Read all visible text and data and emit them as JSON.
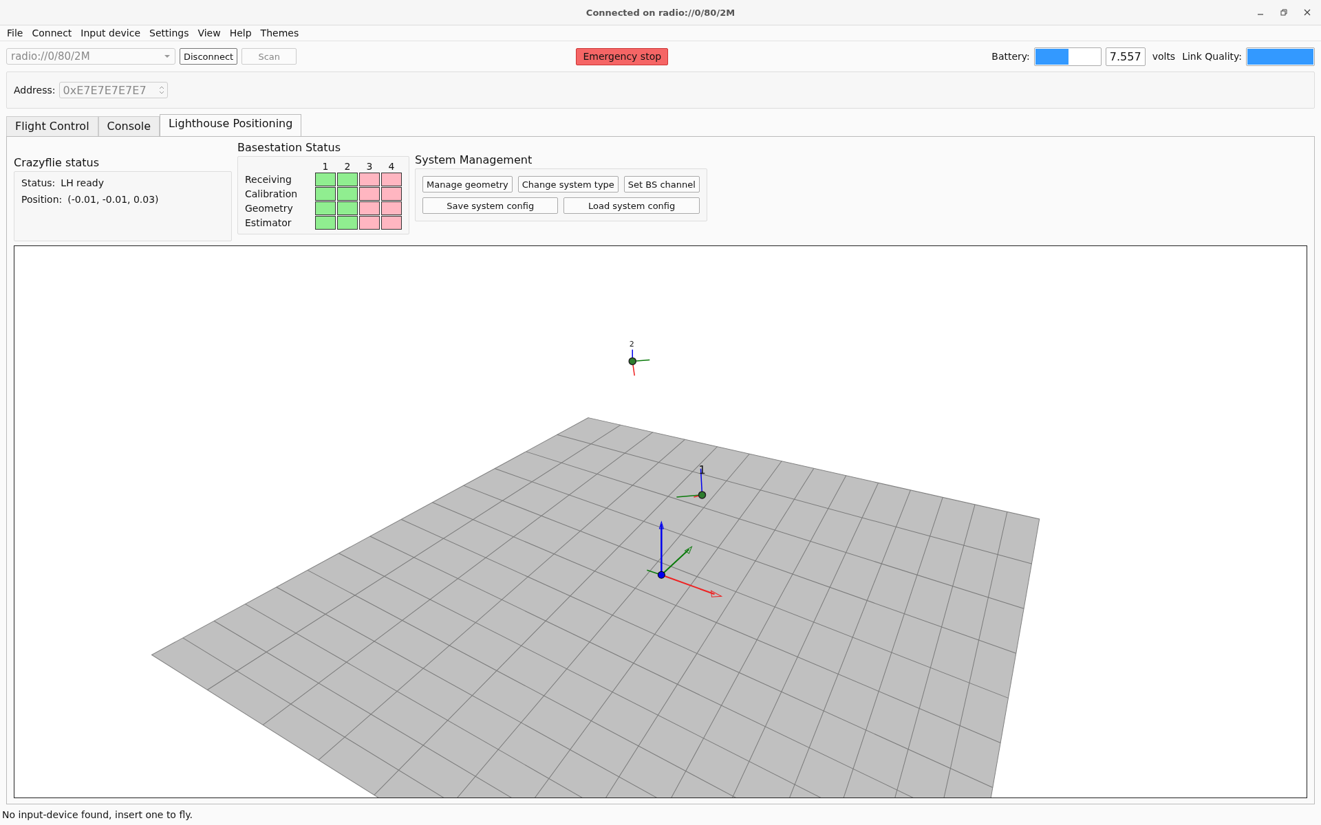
{
  "window": {
    "title": "Connected on radio://0/80/2M"
  },
  "menu": [
    "File",
    "Connect",
    "Input device",
    "Settings",
    "View",
    "Help",
    "Themes"
  ],
  "toolbar": {
    "uri": {
      "value": "radio://0/80/2M",
      "disabled": true
    },
    "buttons": [
      {
        "label": "Disconnect",
        "disabled": false
      },
      {
        "label": "Scan",
        "disabled": true
      }
    ],
    "emergency": "Emergency stop",
    "battery_label": "Battery:",
    "battery": {
      "level": 0.51
    },
    "voltage": "7.557",
    "volts_label": "volts",
    "link_label": "Link Quality:",
    "link": {
      "level": 1.0
    }
  },
  "address": {
    "label": "Address:",
    "value": "0xE7E7E7E7E7",
    "disabled": true
  },
  "tabs": [
    {
      "label": "Flight Control",
      "selected": false
    },
    {
      "label": "Console",
      "selected": false
    },
    {
      "label": "Lighthouse Positioning",
      "selected": true
    }
  ],
  "crazyflie_status": {
    "title": "Crazyflie status",
    "rows": [
      {
        "label": "Status:",
        "value": "LH ready"
      },
      {
        "label": "Position:",
        "value": "(-0.01, -0.01, 0.03)"
      }
    ]
  },
  "basestation_status": {
    "title": "Basestation Status",
    "columns": [
      "1",
      "2",
      "3",
      "4"
    ],
    "rows": [
      {
        "label": "Receiving",
        "cells": [
          true,
          true,
          false,
          false
        ]
      },
      {
        "label": "Calibration",
        "cells": [
          true,
          true,
          false,
          false
        ]
      },
      {
        "label": "Geometry",
        "cells": [
          true,
          true,
          false,
          false
        ]
      },
      {
        "label": "Estimator",
        "cells": [
          true,
          true,
          false,
          false
        ]
      }
    ]
  },
  "system_management": {
    "title": "System Management",
    "rows": [
      [
        "Manage geometry",
        "Change system type",
        "Set BS channel"
      ],
      [
        "Save system config",
        "Load system config"
      ]
    ]
  },
  "scene": {
    "basestations": [
      {
        "label": "1"
      },
      {
        "label": "2"
      }
    ]
  },
  "status_bar": "No input-device found, insert one to fly."
}
